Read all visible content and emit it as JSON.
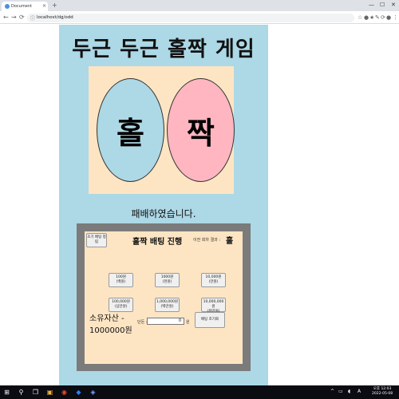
{
  "browser": {
    "tab_title": "Document",
    "tab_close": "×",
    "new_tab": "+",
    "window_controls": [
      "—",
      "☐",
      "✕"
    ],
    "url": "localhost/dg/odd",
    "nav": {
      "back": "←",
      "forward": "→",
      "reload": "⟳"
    },
    "toolbar_icons": [
      "☆",
      "●",
      "★",
      "✎",
      "⟳",
      "●",
      "⋮"
    ]
  },
  "page": {
    "title": "두근 두근 홀짝 게임",
    "odd_label": "홀",
    "even_label": "짝",
    "result_message": "패배하였습니다.",
    "colors": {
      "background": "#add8e6",
      "panel": "#fde5c3",
      "odd": "#add8e6",
      "even": "#ffb6c1",
      "frame": "#7b7b7b"
    }
  },
  "betting": {
    "reset_button": "초기 배팅 정립",
    "title": "홀짝 배팅 진행",
    "last_result_label": "이전 회차 결과 :",
    "last_result_value": "홀",
    "amounts": [
      {
        "line1": "100원",
        "line2": "(백원)"
      },
      {
        "line1": "1000원",
        "line2": "(천원)"
      },
      {
        "line1": "10,000원",
        "line2": "(만원)"
      },
      {
        "line1": "100,000원",
        "line2": "(십만원)"
      },
      {
        "line1": "1,000,000원",
        "line2": "(백만원)"
      },
      {
        "line1": "10,000,000원",
        "line2": "(천만원)"
      }
    ],
    "assets_label": "소유자산 -",
    "assets_value": "1000000원",
    "unit_label": "단돈 :",
    "unit_value": "0",
    "won": "원",
    "confirm_button": "배팅 조기화"
  },
  "taskbar": {
    "start_icon": "⊞",
    "search_icon": "⚲",
    "task_view": "❐",
    "apps": [
      "▣",
      "◉",
      "◆",
      "◈"
    ],
    "tray_icons": [
      "^",
      "▭",
      "◖",
      "A"
    ],
    "time": "오후 12:03",
    "date": "2022-05-08"
  }
}
